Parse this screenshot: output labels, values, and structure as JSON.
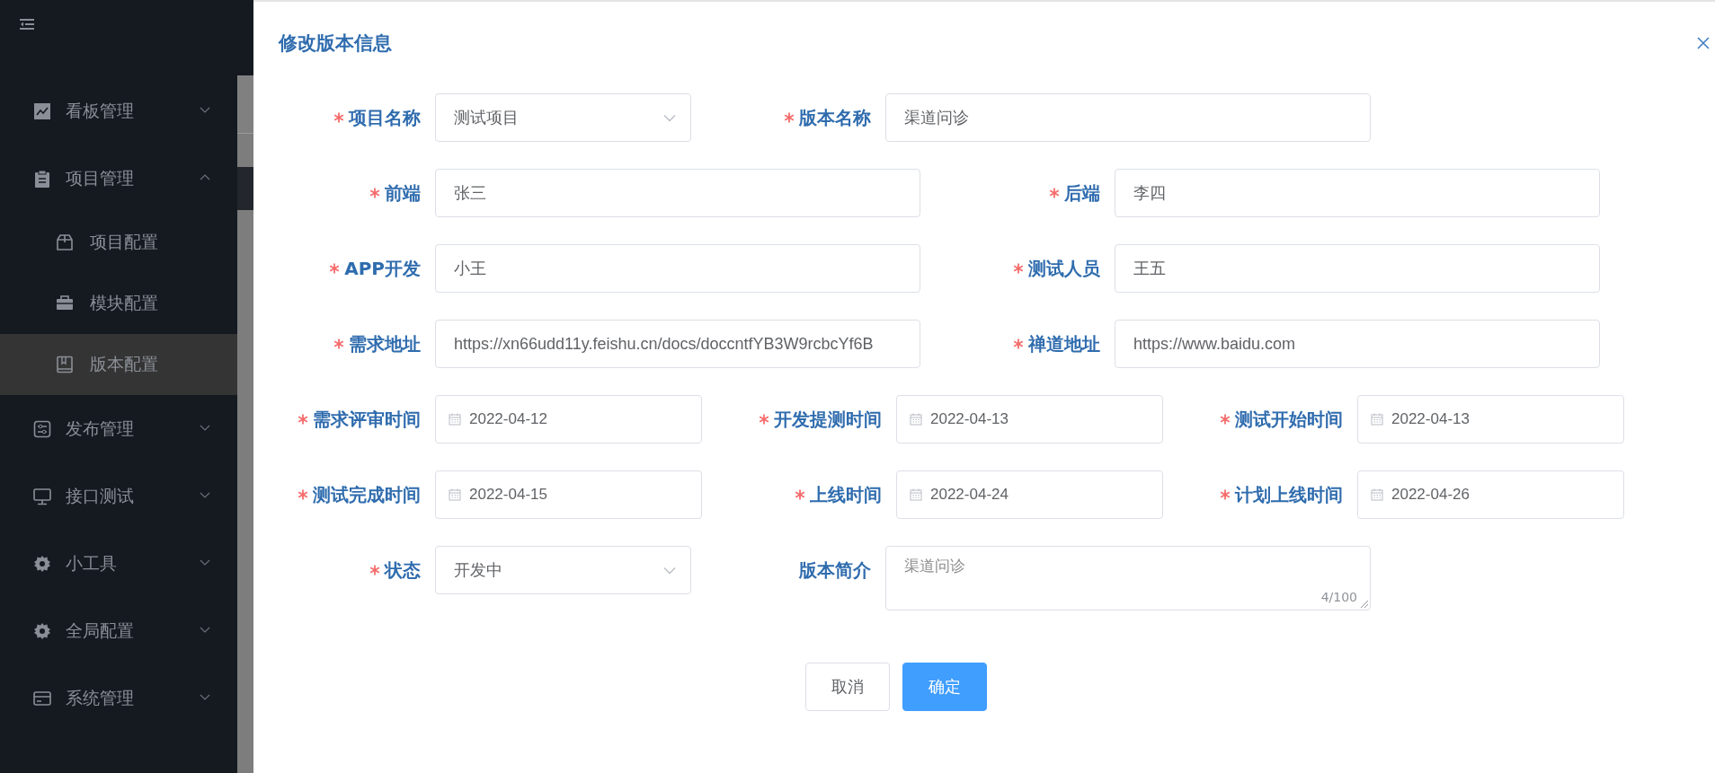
{
  "sidebar": {
    "items": [
      {
        "label": "看板管理",
        "expanded": false
      },
      {
        "label": "项目管理",
        "expanded": true,
        "children": [
          {
            "label": "项目配置",
            "selected": false
          },
          {
            "label": "模块配置",
            "selected": false
          },
          {
            "label": "版本配置",
            "selected": true
          }
        ]
      },
      {
        "label": "发布管理",
        "expanded": false
      },
      {
        "label": "接口测试",
        "expanded": false
      },
      {
        "label": "小工具",
        "expanded": false
      },
      {
        "label": "全局配置",
        "expanded": false
      },
      {
        "label": "系统管理",
        "expanded": false
      }
    ]
  },
  "dialog": {
    "title": "修改版本信息",
    "rows": [
      {
        "fields": [
          {
            "label": "项目名称",
            "required": true,
            "kind": "select",
            "value": "测试项目"
          },
          {
            "label": "版本名称",
            "required": true,
            "kind": "input",
            "value": "渠道问诊"
          }
        ]
      },
      {
        "fields": [
          {
            "label": "前端",
            "required": true,
            "kind": "input",
            "value": "张三"
          },
          {
            "label": "后端",
            "required": true,
            "kind": "input",
            "value": "李四"
          }
        ]
      },
      {
        "fields": [
          {
            "label": "APP开发",
            "required": true,
            "kind": "input",
            "value": "小王"
          },
          {
            "label": "测试人员",
            "required": true,
            "kind": "input",
            "value": "王五"
          }
        ]
      },
      {
        "fields": [
          {
            "label": "需求地址",
            "required": true,
            "kind": "input",
            "value": "https://xn66udd11y.feishu.cn/docs/doccntfYB3W9rcbcYf6B"
          },
          {
            "label": "禅道地址",
            "required": true,
            "kind": "input",
            "value": "https://www.baidu.com"
          }
        ]
      },
      {
        "fields": [
          {
            "label": "需求评审时间",
            "required": true,
            "kind": "date",
            "value": "2022-04-12"
          },
          {
            "label": "开发提测时间",
            "required": true,
            "kind": "date",
            "value": "2022-04-13"
          },
          {
            "label": "测试开始时间",
            "required": true,
            "kind": "date",
            "value": "2022-04-13"
          }
        ]
      },
      {
        "fields": [
          {
            "label": "测试完成时间",
            "required": true,
            "kind": "date",
            "value": "2022-04-15"
          },
          {
            "label": "上线时间",
            "required": true,
            "kind": "date",
            "value": "2022-04-24"
          },
          {
            "label": "计划上线时间",
            "required": true,
            "kind": "date",
            "value": "2022-04-26"
          }
        ]
      },
      {
        "fields": [
          {
            "label": "状态",
            "required": true,
            "kind": "select",
            "value": "开发中"
          },
          {
            "label": "版本简介",
            "required": false,
            "kind": "textarea",
            "value": "渠道问诊",
            "counter": "4/100"
          }
        ]
      }
    ],
    "buttons": [
      {
        "label": "取消",
        "kind": "default"
      },
      {
        "label": "确定",
        "kind": "primary"
      }
    ]
  }
}
